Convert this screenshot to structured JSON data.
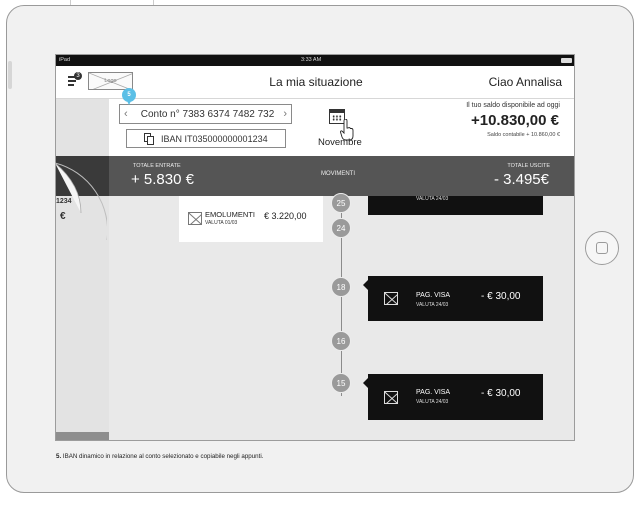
{
  "status_bar": {
    "carrier": "iPad",
    "time": "3:33 AM"
  },
  "header": {
    "menu_badge": "3",
    "logo_text": "Logo",
    "title": "La mia situazione",
    "greeting": "Ciao Annalisa"
  },
  "account": {
    "label": "Conto n° 7383 6374 7482 732",
    "iban": "IBAN IT035000000001234",
    "badge_number": "5",
    "month": "Novembre",
    "balance_label": "Il tuo saldo disponibile ad oggi",
    "balance_value": "+10.830,00 €",
    "balance_sub": "Saldo contabile + 10.860,00 €"
  },
  "totals": {
    "in_label": "TOTALE ENTRATE",
    "in_value": "+ 5.830 €",
    "middle": "MOVIMENTI",
    "out_label": "TOTALE USCITE",
    "out_value": "- 3.495€"
  },
  "timeline": {
    "days": [
      "25",
      "24",
      "18",
      "16",
      "15"
    ],
    "income": {
      "title": "EMOLUMENTI",
      "sub": "VALUTA 01/03",
      "amount": "€ 3.220,00"
    },
    "top_card_sub": "VALUTA 24/03",
    "expenses": [
      {
        "title": "PAG. VISA",
        "sub": "VALUTA 24/03",
        "amount": "- € 30,00"
      },
      {
        "title": "PAG. VISA",
        "sub": "VALUTA 24/03",
        "amount": "- € 30,00"
      }
    ]
  },
  "left_panel": {
    "number": "1234",
    "currency": "€"
  },
  "caption": {
    "number": "5.",
    "text": " IBAN dinamico in relazione al conto selezionato e copiabile negli appunti."
  },
  "icons": [
    "menu-icon",
    "copy-icon",
    "calendar-icon",
    "hand-pointer-icon",
    "image-placeholder-icon",
    "chevron-left-icon",
    "chevron-right-icon",
    "battery-icon",
    "home-button-icon"
  ],
  "colors": {
    "badge": "#5bbfe6",
    "totals_bar": "#555555",
    "expense_card": "#111111"
  }
}
